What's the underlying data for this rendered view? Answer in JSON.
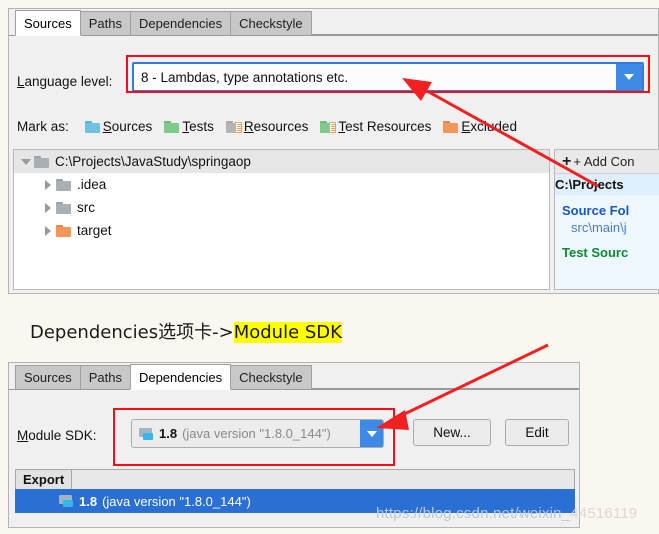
{
  "page": {
    "background_color": "#faf7f0",
    "annotation_color": "#fb0d11",
    "highlight_color": "#ffff00"
  },
  "caption": {
    "prefix": "Dependencies选项卡->",
    "highlighted": "Module SDK"
  },
  "sources_panel": {
    "tabs": [
      {
        "label": "Sources",
        "selected": true
      },
      {
        "label": "Paths",
        "selected": false
      },
      {
        "label": "Dependencies",
        "selected": false
      },
      {
        "label": "Checkstyle",
        "selected": false
      }
    ],
    "language_level": {
      "label": "Language level:",
      "label_mnemonic": "L",
      "label_rest": "anguage level:",
      "value": "8 - Lambdas, type annotations etc.",
      "arrow_icon": "chevron-down-icon",
      "arrow_color": "#3d8ae5",
      "focus_border_color": "#2a7fe0"
    },
    "mark_as": {
      "label": "Mark as:",
      "items": [
        {
          "label": "Sources",
          "mnemonic": "S",
          "rest": "ources",
          "icon": "folder-icon",
          "color": "#6fc3e0"
        },
        {
          "label": "Tests",
          "mnemonic": "T",
          "rest": "ests",
          "icon": "folder-icon",
          "color": "#7fc98a"
        },
        {
          "label": "Resources",
          "mnemonic": "R",
          "rest": "esources",
          "icon": "folder-lines-icon",
          "color": "#b5b5b5"
        },
        {
          "label": "Test Resources",
          "mnemonic": "T",
          "rest": "est Resources",
          "icon": "folder-lines-icon",
          "color": "#7fc98a"
        },
        {
          "label": "Excluded",
          "mnemonic": "E",
          "rest": "xcluded",
          "icon": "folder-icon",
          "color": "#f2975c"
        }
      ]
    },
    "tree": [
      {
        "label": "C:\\Projects\\JavaStudy\\springaop",
        "expanded": true,
        "selected": true,
        "depth": 0,
        "folder_color": "#a8b0b5"
      },
      {
        "label": ".idea",
        "expanded": false,
        "selected": false,
        "depth": 1,
        "folder_color": "#a8b0b5"
      },
      {
        "label": "src",
        "expanded": false,
        "selected": false,
        "depth": 1,
        "folder_color": "#a8b0b5"
      },
      {
        "label": "target",
        "expanded": false,
        "selected": false,
        "depth": 1,
        "folder_color": "#f2975c"
      }
    ],
    "details": {
      "add_content_root": "+ Add Con",
      "content_path": "C:\\Projects",
      "source_folders_header": "Source Fol",
      "source_folder_item": "src\\main\\j",
      "test_source_header": "Test Sourc"
    }
  },
  "dependencies_panel": {
    "tabs": [
      {
        "label": "Sources",
        "selected": false
      },
      {
        "label": "Paths",
        "selected": false
      },
      {
        "label": "Dependencies",
        "selected": true
      },
      {
        "label": "Checkstyle",
        "selected": false
      }
    ],
    "module_sdk": {
      "label": "Module SDK:",
      "label_mnemonic": "M",
      "label_rest": "odule SDK:",
      "value_version": "1.8",
      "value_detail": "(java version \"1.8.0_144\")",
      "icon": "java-sdk-icon",
      "arrow_icon": "chevron-down-icon",
      "arrow_color": "#3d8ae5"
    },
    "buttons": [
      {
        "label": "New...",
        "name": "new-sdk-button"
      },
      {
        "label": "Edit",
        "name": "edit-sdk-button"
      }
    ],
    "export_tab": "Export",
    "selected_entry": {
      "version": "1.8",
      "detail": "(java version \"1.8.0_144\")",
      "icon": "java-sdk-icon"
    }
  },
  "watermark": {
    "text_bright": "https://blog.csdn.net/weixin_",
    "text_dim": "44516119"
  }
}
